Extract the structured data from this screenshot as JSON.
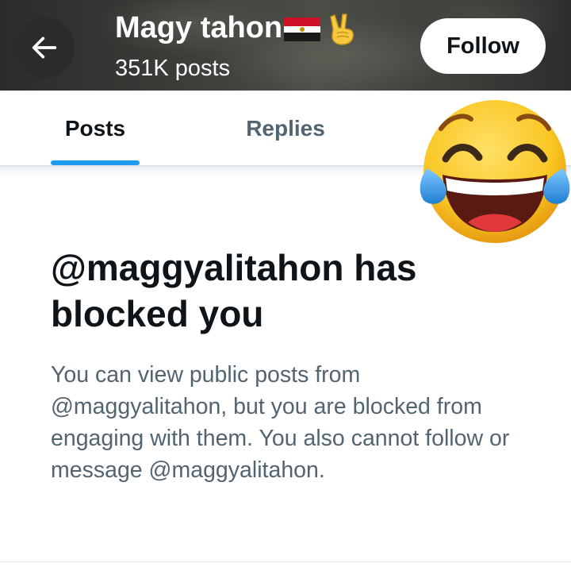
{
  "header": {
    "profile_name": "Magy tahon",
    "post_count": "351K posts",
    "follow_label": "Follow",
    "name_emojis": [
      "egypt-flag-icon",
      "victory-hand-icon"
    ]
  },
  "tabs": [
    {
      "label": "Posts",
      "active": true
    },
    {
      "label": "Replies",
      "active": false
    }
  ],
  "blocked": {
    "title": "@maggyalitahon has blocked you",
    "description": "You can view public posts from @maggyalitahon, but you are blocked from engaging with them. You also cannot follow or message @maggyalitahon."
  },
  "overlay": {
    "icon": "tears-of-joy-emoji"
  },
  "colors": {
    "accent": "#1d9bf0",
    "primary_text": "#0f1419",
    "secondary_text": "#536471"
  }
}
